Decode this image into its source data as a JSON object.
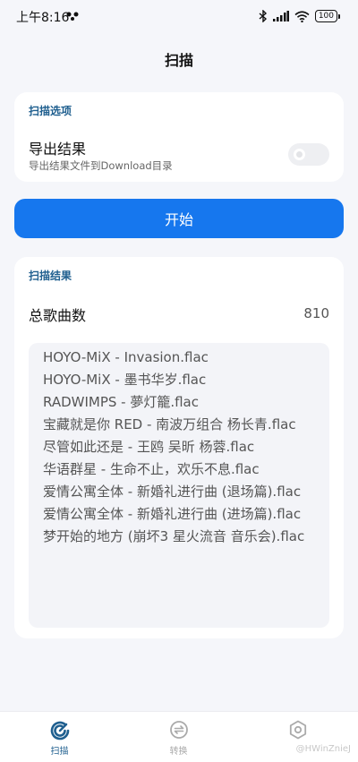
{
  "status_bar": {
    "time": "上午8:16",
    "battery": "100"
  },
  "page_title": "扫描",
  "options": {
    "section_label": "扫描选项",
    "export_title": "导出结果",
    "export_desc": "导出结果文件到Download目录",
    "export_enabled": false
  },
  "start_button_label": "开始",
  "results": {
    "section_label": "扫描结果",
    "total_label": "总歌曲数",
    "total_value": "810",
    "songs": [
      "HOYO-MiX - Invasion.flac",
      "HOYO-MiX - 墨书华岁.flac",
      "RADWIMPS - 夢灯籠.flac",
      "宝藏就是你 RED - 南波万组合 杨长青.flac",
      "尽管如此还是 - 王鸥 吴昕 杨蓉.flac",
      "华语群星 - 生命不止，欢乐不息.flac",
      "爱情公寓全体 - 新婚礼进行曲 (退场篇).flac",
      "爱情公寓全体 - 新婚礼进行曲 (进场篇).flac",
      "梦开始的地方 (崩坏3 星火流音 音乐会).flac"
    ]
  },
  "nav": [
    {
      "label": "扫描",
      "icon": "scan-icon",
      "active": true
    },
    {
      "label": "转换",
      "icon": "convert-icon",
      "active": false
    },
    {
      "label": "设置",
      "icon": "settings-icon",
      "active": false
    }
  ],
  "watermark": "@HWinZnieJ",
  "colors": {
    "accent": "#1677ee",
    "section_label": "#1f5f8f",
    "background": "#f5f6fa"
  }
}
